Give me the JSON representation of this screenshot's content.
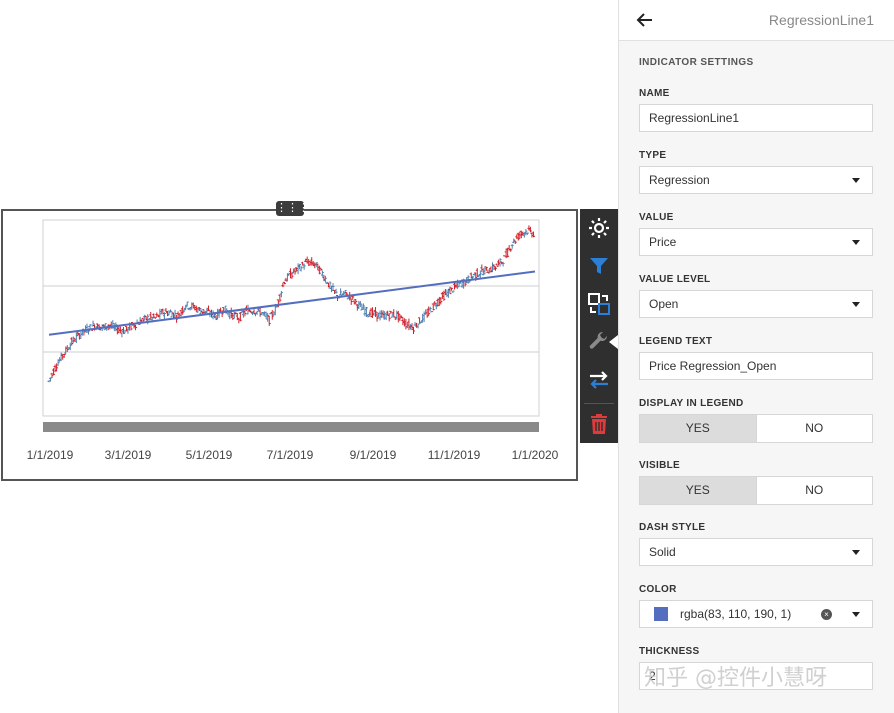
{
  "panel": {
    "title": "RegressionLine1",
    "section_title": "INDICATOR SETTINGS",
    "fields": {
      "name": {
        "label": "NAME",
        "value": "RegressionLine1"
      },
      "type": {
        "label": "TYPE",
        "value": "Regression"
      },
      "value": {
        "label": "VALUE",
        "value": "Price"
      },
      "value_level": {
        "label": "VALUE LEVEL",
        "value": "Open"
      },
      "legend_text": {
        "label": "LEGEND TEXT",
        "value": "Price Regression_Open"
      },
      "display_in_legend": {
        "label": "DISPLAY IN LEGEND",
        "yes": "YES",
        "no": "NO",
        "selected": "YES"
      },
      "visible": {
        "label": "VISIBLE",
        "yes": "YES",
        "no": "NO",
        "selected": "YES"
      },
      "dash_style": {
        "label": "DASH STYLE",
        "value": "Solid"
      },
      "color": {
        "label": "COLOR",
        "value": "rgba(83, 110, 190, 1)",
        "swatch": "#536ebe"
      },
      "thickness": {
        "label": "THICKNESS",
        "value": "2"
      }
    }
  },
  "toolbar": {
    "icons": [
      "gear-icon",
      "filter-icon",
      "convert-icon",
      "wrench-icon",
      "swap-icon",
      "trash-icon"
    ]
  },
  "watermark": "知乎 @控件小慧呀",
  "colors": {
    "up": "#4f7fb0",
    "down": "#d0202a",
    "regression": "#536ebe",
    "toolbar_bg": "#2f2f2f",
    "filter": "#2b7fd6",
    "trash": "#e03a3a"
  },
  "chart_data": {
    "type": "line",
    "x_tick_labels": [
      "1/1/2019",
      "3/1/2019",
      "5/1/2019",
      "7/1/2019",
      "9/1/2019",
      "11/1/2019",
      "1/1/2020"
    ],
    "price_series": [
      [
        0,
        16
      ],
      [
        5,
        25
      ],
      [
        10,
        31
      ],
      [
        15,
        37
      ],
      [
        20,
        41
      ],
      [
        25,
        44
      ],
      [
        30,
        46
      ],
      [
        35,
        45
      ],
      [
        40,
        46
      ],
      [
        45,
        44
      ],
      [
        50,
        43
      ],
      [
        55,
        46
      ],
      [
        60,
        48
      ],
      [
        65,
        50
      ],
      [
        70,
        50
      ],
      [
        75,
        53
      ],
      [
        80,
        53
      ],
      [
        85,
        51
      ],
      [
        90,
        57
      ],
      [
        95,
        56
      ],
      [
        100,
        54
      ],
      [
        105,
        53
      ],
      [
        110,
        51
      ],
      [
        115,
        55
      ],
      [
        120,
        52
      ],
      [
        125,
        50
      ],
      [
        130,
        54
      ],
      [
        135,
        54
      ],
      [
        140,
        53
      ],
      [
        145,
        49
      ],
      [
        150,
        56
      ],
      [
        155,
        70
      ],
      [
        160,
        74
      ],
      [
        165,
        77
      ],
      [
        170,
        80
      ],
      [
        175,
        79
      ],
      [
        180,
        74
      ],
      [
        185,
        67
      ],
      [
        190,
        62
      ],
      [
        195,
        63
      ],
      [
        200,
        60
      ],
      [
        205,
        56
      ],
      [
        210,
        53
      ],
      [
        215,
        52
      ],
      [
        220,
        51
      ],
      [
        225,
        52
      ],
      [
        230,
        51
      ],
      [
        235,
        47
      ],
      [
        240,
        45
      ],
      [
        245,
        49
      ],
      [
        250,
        53
      ],
      [
        255,
        58
      ],
      [
        260,
        62
      ],
      [
        265,
        65
      ],
      [
        270,
        68
      ],
      [
        275,
        70
      ],
      [
        280,
        73
      ],
      [
        285,
        75
      ],
      [
        290,
        76
      ],
      [
        295,
        78
      ],
      [
        300,
        82
      ],
      [
        305,
        90
      ],
      [
        310,
        95
      ],
      [
        315,
        97
      ],
      [
        320,
        95
      ]
    ],
    "regression": {
      "x": [
        0,
        320
      ],
      "y": [
        41,
        75
      ]
    }
  }
}
